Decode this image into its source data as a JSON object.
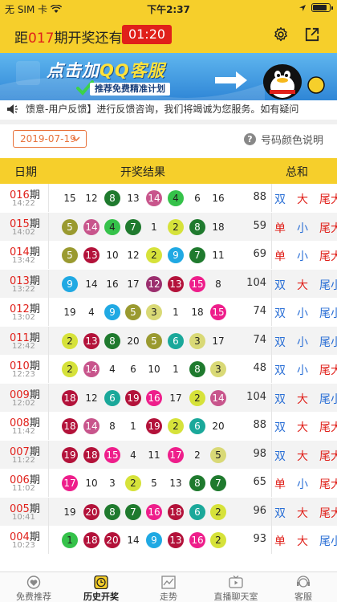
{
  "status_bar": {
    "carrier": "无 SIM 卡",
    "time": "下午2:37"
  },
  "header": {
    "prefix": "距",
    "period": "017",
    "suffix": "期开奖还有",
    "timer": "01:20"
  },
  "banner": {
    "line1_a": "点击加",
    "line1_b": "QQ客服",
    "line2": "推荐免费精准计划"
  },
  "marquee": {
    "text": "馈意-用户反馈】进行反馈咨询，我们将竭诚为您服务。如有疑问"
  },
  "filter": {
    "date": "2019-07-19",
    "help": "号码颜色说明"
  },
  "table": {
    "headers": {
      "period": "日期",
      "result": "开奖结果",
      "sum": "总和"
    },
    "rows": [
      {
        "period": "016",
        "time": "14:22",
        "balls": [
          [
            "15",
            "plain"
          ],
          [
            "12",
            "plain"
          ],
          [
            "8",
            "green"
          ],
          [
            "13",
            "plain"
          ],
          [
            "14",
            "pink"
          ],
          [
            "4",
            "lgreen"
          ],
          [
            "6",
            "plain"
          ],
          [
            "16",
            "plain"
          ]
        ],
        "sum": "88",
        "a1": "双",
        "a2": "大",
        "a3": "尾大"
      },
      {
        "period": "015",
        "time": "14:02",
        "balls": [
          [
            "5",
            "olive"
          ],
          [
            "14",
            "pink"
          ],
          [
            "4",
            "lgreen"
          ],
          [
            "7",
            "green"
          ],
          [
            "1",
            "plain"
          ],
          [
            "2",
            "yellow"
          ],
          [
            "8",
            "green"
          ],
          [
            "18",
            "plain"
          ]
        ],
        "sum": "59",
        "a1": "单",
        "a2": "小",
        "a3": "尾大"
      },
      {
        "period": "014",
        "time": "13:42",
        "balls": [
          [
            "5",
            "olive"
          ],
          [
            "13",
            "crimson"
          ],
          [
            "10",
            "plain"
          ],
          [
            "12",
            "plain"
          ],
          [
            "2",
            "yellow"
          ],
          [
            "9",
            "cyan"
          ],
          [
            "7",
            "green"
          ],
          [
            "11",
            "plain"
          ]
        ],
        "sum": "69",
        "a1": "单",
        "a2": "小",
        "a3": "尾大"
      },
      {
        "period": "013",
        "time": "13:22",
        "balls": [
          [
            "9",
            "cyan"
          ],
          [
            "14",
            "plain"
          ],
          [
            "16",
            "plain"
          ],
          [
            "17",
            "plain"
          ],
          [
            "12",
            "purple"
          ],
          [
            "13",
            "crimson"
          ],
          [
            "15",
            "magenta"
          ],
          [
            "8",
            "plain"
          ]
        ],
        "sum": "104",
        "a1": "双",
        "a2": "大",
        "a3": "尾小"
      },
      {
        "period": "012",
        "time": "13:02",
        "balls": [
          [
            "19",
            "plain"
          ],
          [
            "4",
            "plain"
          ],
          [
            "9",
            "cyan"
          ],
          [
            "5",
            "olive"
          ],
          [
            "3",
            "khaki"
          ],
          [
            "1",
            "plain"
          ],
          [
            "18",
            "plain"
          ],
          [
            "15",
            "magenta"
          ]
        ],
        "sum": "74",
        "a1": "双",
        "a2": "小",
        "a3": "尾小"
      },
      {
        "period": "011",
        "time": "12:42",
        "balls": [
          [
            "2",
            "yellow"
          ],
          [
            "13",
            "crimson"
          ],
          [
            "8",
            "green"
          ],
          [
            "20",
            "plain"
          ],
          [
            "5",
            "olive"
          ],
          [
            "6",
            "teal"
          ],
          [
            "3",
            "khaki"
          ],
          [
            "17",
            "plain"
          ]
        ],
        "sum": "74",
        "a1": "双",
        "a2": "小",
        "a3": "尾小"
      },
      {
        "period": "010",
        "time": "12:23",
        "balls": [
          [
            "2",
            "yellow"
          ],
          [
            "14",
            "pink"
          ],
          [
            "4",
            "plain"
          ],
          [
            "6",
            "plain"
          ],
          [
            "10",
            "plain"
          ],
          [
            "1",
            "plain"
          ],
          [
            "8",
            "green"
          ],
          [
            "3",
            "khaki"
          ]
        ],
        "sum": "48",
        "a1": "双",
        "a2": "小",
        "a3": "尾大"
      },
      {
        "period": "009",
        "time": "12:02",
        "balls": [
          [
            "18",
            "crimson"
          ],
          [
            "12",
            "plain"
          ],
          [
            "6",
            "teal"
          ],
          [
            "19",
            "crimson"
          ],
          [
            "16",
            "magenta"
          ],
          [
            "17",
            "plain"
          ],
          [
            "2",
            "yellow"
          ],
          [
            "14",
            "pink"
          ]
        ],
        "sum": "104",
        "a1": "双",
        "a2": "大",
        "a3": "尾小"
      },
      {
        "period": "008",
        "time": "11:42",
        "balls": [
          [
            "18",
            "crimson"
          ],
          [
            "14",
            "pink"
          ],
          [
            "8",
            "plain"
          ],
          [
            "1",
            "plain"
          ],
          [
            "19",
            "crimson"
          ],
          [
            "2",
            "yellow"
          ],
          [
            "6",
            "teal"
          ],
          [
            "20",
            "plain"
          ]
        ],
        "sum": "88",
        "a1": "双",
        "a2": "大",
        "a3": "尾大"
      },
      {
        "period": "007",
        "time": "11:22",
        "balls": [
          [
            "19",
            "crimson"
          ],
          [
            "18",
            "crimson"
          ],
          [
            "15",
            "magenta"
          ],
          [
            "4",
            "plain"
          ],
          [
            "11",
            "plain"
          ],
          [
            "17",
            "magenta"
          ],
          [
            "2",
            "plain"
          ],
          [
            "5",
            "khaki"
          ]
        ],
        "sum": "98",
        "a1": "双",
        "a2": "大",
        "a3": "尾大"
      },
      {
        "period": "006",
        "time": "11:02",
        "balls": [
          [
            "17",
            "magenta"
          ],
          [
            "10",
            "plain"
          ],
          [
            "3",
            "plain"
          ],
          [
            "2",
            "yellow"
          ],
          [
            "5",
            "plain"
          ],
          [
            "13",
            "plain"
          ],
          [
            "8",
            "green"
          ],
          [
            "7",
            "green"
          ]
        ],
        "sum": "65",
        "a1": "单",
        "a2": "小",
        "a3": "尾大"
      },
      {
        "period": "005",
        "time": "10:41",
        "balls": [
          [
            "19",
            "plain"
          ],
          [
            "20",
            "crimson"
          ],
          [
            "8",
            "green"
          ],
          [
            "7",
            "green"
          ],
          [
            "16",
            "magenta"
          ],
          [
            "18",
            "crimson"
          ],
          [
            "6",
            "teal"
          ],
          [
            "2",
            "yellow"
          ]
        ],
        "sum": "96",
        "a1": "双",
        "a2": "大",
        "a3": "尾大"
      },
      {
        "period": "004",
        "time": "10:23",
        "balls": [
          [
            "1",
            "lgreen"
          ],
          [
            "18",
            "crimson"
          ],
          [
            "20",
            "crimson"
          ],
          [
            "14",
            "plain"
          ],
          [
            "9",
            "cyan"
          ],
          [
            "13",
            "crimson"
          ],
          [
            "16",
            "magenta"
          ],
          [
            "2",
            "yellow"
          ]
        ],
        "sum": "93",
        "a1": "单",
        "a2": "大",
        "a3": "尾小"
      }
    ]
  },
  "colors": {
    "green": "#1f7a2e",
    "lgreen": "#35c24a",
    "pink": "#c8558c",
    "olive": "#9a9a30",
    "yellow": "#d6e23a",
    "crimson": "#b3123a",
    "cyan": "#20a9e3",
    "purple": "#9b2f6e",
    "magenta": "#ee1e8b",
    "khaki": "#d9d976",
    "teal": "#1aa89a"
  },
  "tabbar": [
    {
      "label": "免费推荐",
      "icon": "heart-icon"
    },
    {
      "label": "历史开奖",
      "icon": "clock-icon"
    },
    {
      "label": "走势",
      "icon": "trend-chart-icon"
    },
    {
      "label": "直播聊天室",
      "icon": "live-tv-icon"
    },
    {
      "label": "客服",
      "icon": "headset-icon"
    }
  ]
}
